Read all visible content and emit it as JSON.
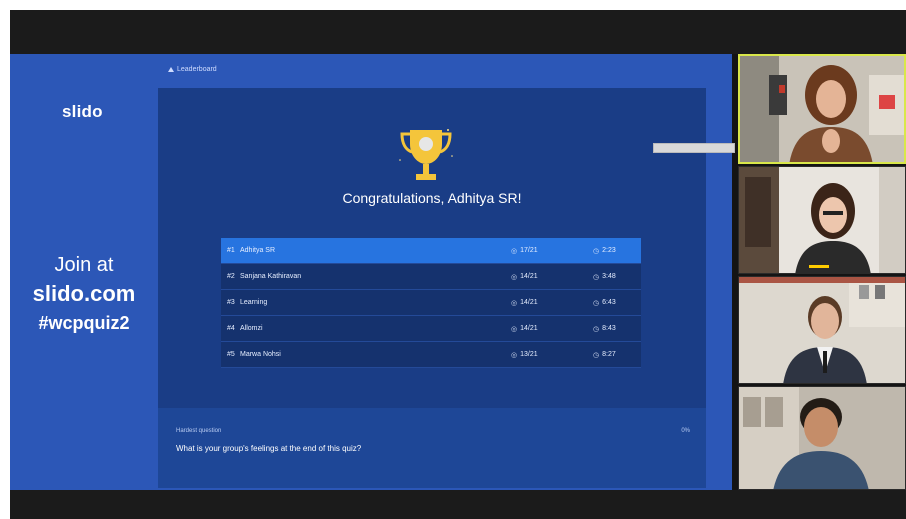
{
  "slido": {
    "logo": "slido",
    "join_line1": "Join at",
    "join_line2": "slido.com",
    "join_line3": "#wcpquiz2",
    "leaderboard_label": "Leaderboard",
    "congratulations": "Congratulations, Adhitya SR!",
    "leaderboard": [
      {
        "rank": "#1",
        "name": "Adhitya SR",
        "score": "17/21",
        "time": "2:23"
      },
      {
        "rank": "#2",
        "name": "Sanjana Kathiravan",
        "score": "14/21",
        "time": "3:48"
      },
      {
        "rank": "#3",
        "name": "Learning",
        "score": "14/21",
        "time": "6:43"
      },
      {
        "rank": "#4",
        "name": "Allomzi",
        "score": "14/21",
        "time": "8:43"
      },
      {
        "rank": "#5",
        "name": "Marwa Nohsi",
        "score": "13/21",
        "time": "8:27"
      }
    ],
    "question_label": "Hardest question",
    "question_text": "What is your group's feelings at the end of this quiz?",
    "question_percent": "0%"
  },
  "icons": {
    "score": "check-circle-icon",
    "time": "clock-icon",
    "trophy": "trophy-icon",
    "leaderboard": "triangle-up-icon"
  },
  "colors": {
    "slide_bg": "#2c57b7",
    "panel_bg": "#1a3d86",
    "highlight_row": "#2774e0",
    "active_speaker_border": "#d9e74a"
  }
}
